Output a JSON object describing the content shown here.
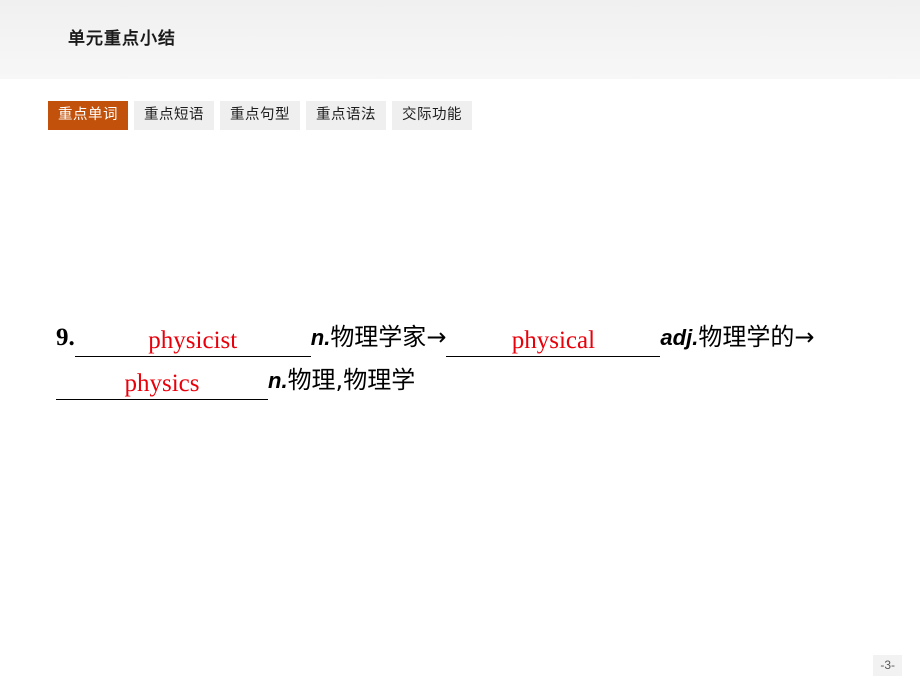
{
  "header": {
    "title": "单元重点小结",
    "band_color": "#f2f2f2"
  },
  "tabs": {
    "active_index": 0,
    "active_color": "#c1510b",
    "inactive_color": "#efefef",
    "items": [
      {
        "label": "重点单词"
      },
      {
        "label": "重点短语"
      },
      {
        "label": "重点句型"
      },
      {
        "label": "重点语法"
      },
      {
        "label": "交际功能"
      }
    ]
  },
  "content": {
    "entry": {
      "number": "9.",
      "blank1_answer": "physicist",
      "pos1": "n.",
      "meaning1": "物理学家",
      "arrow1": "→",
      "blank2_answer": "physical",
      "pos2": "adj.",
      "meaning2": "物理学的",
      "arrow2": "→",
      "blank3_answer": "physics",
      "pos3": "n.",
      "meaning3": "物理,物理学",
      "answer_color": "#e8000b"
    }
  },
  "footer": {
    "page_number": "-3-"
  }
}
